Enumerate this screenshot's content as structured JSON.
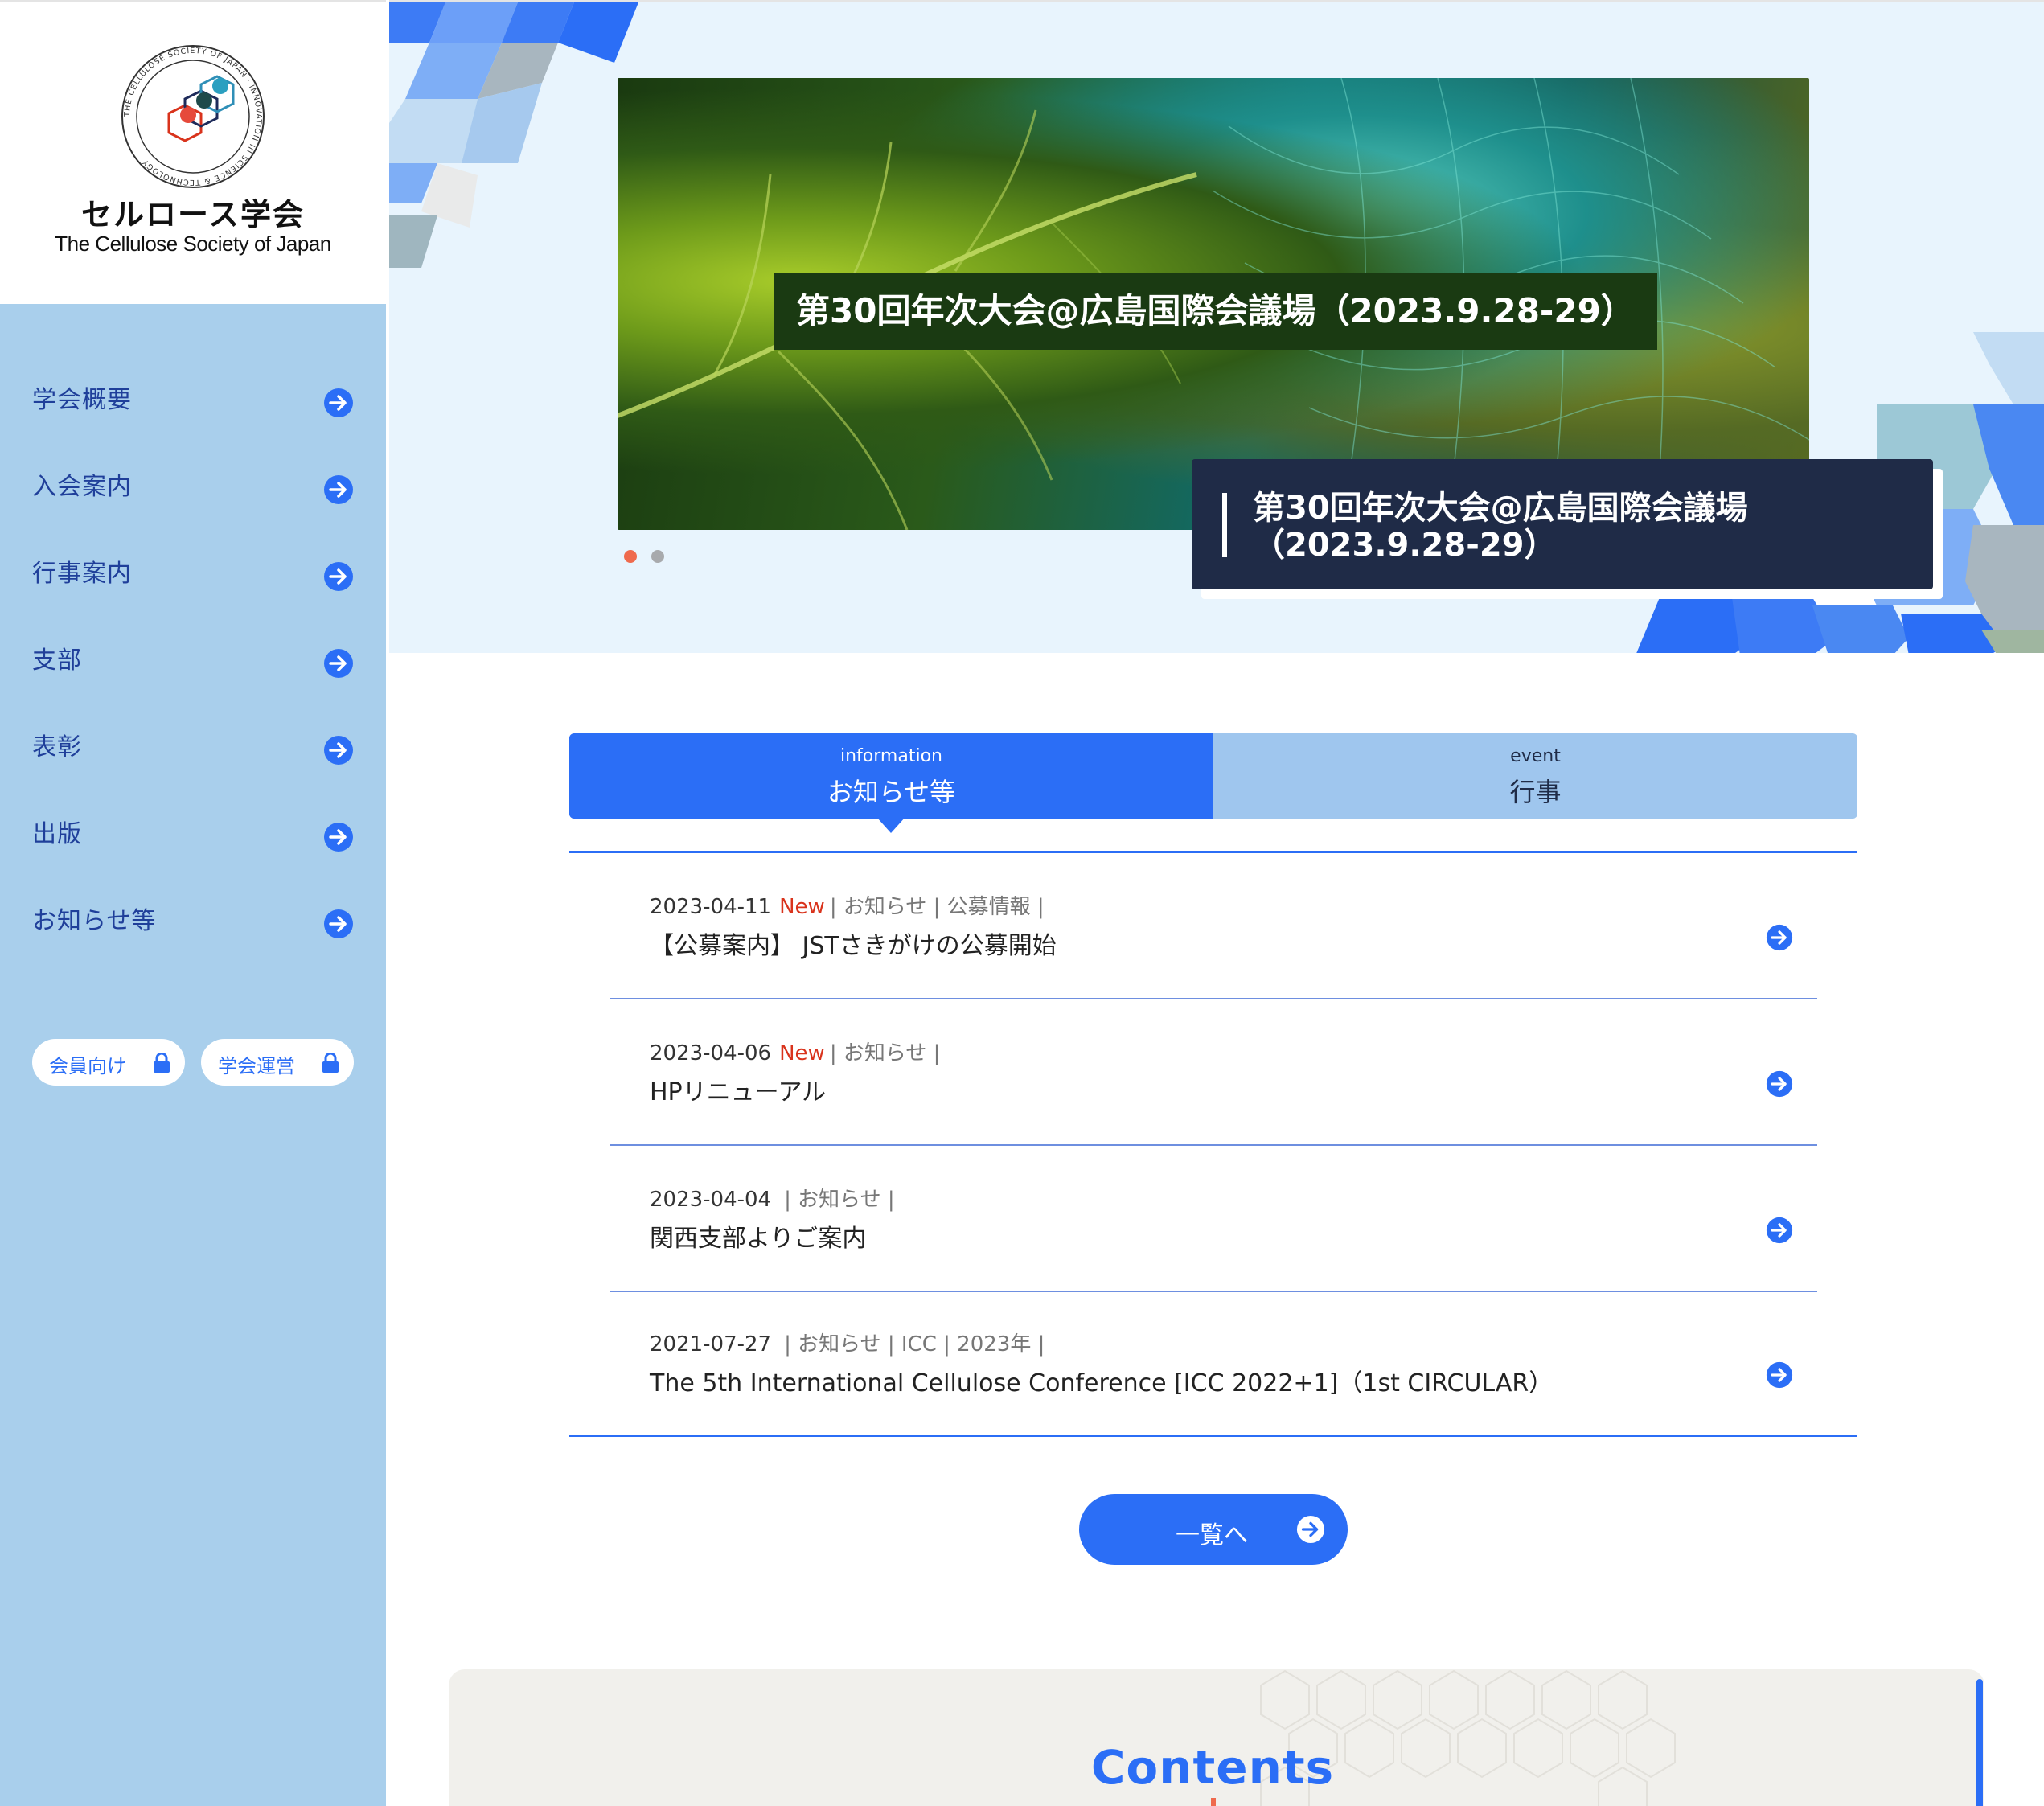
{
  "site": {
    "name_jp": "セルロース学会",
    "name_en": "The Cellulose Society of Japan",
    "logo_ring_text": "THE CELLULOSE SOCIETY OF JAPAN · INNOVATION IN SCIENCE & TECHNOLOGY"
  },
  "sidebar": {
    "nav": [
      {
        "label": "学会概要",
        "icon": "arrow-right-circle-icon"
      },
      {
        "label": "入会案内",
        "icon": "arrow-right-circle-icon"
      },
      {
        "label": "行事案内",
        "icon": "arrow-right-circle-icon"
      },
      {
        "label": "支部",
        "icon": "arrow-right-circle-icon"
      },
      {
        "label": "表彰",
        "icon": "arrow-right-circle-icon"
      },
      {
        "label": "出版",
        "icon": "arrow-right-circle-icon"
      },
      {
        "label": "お知らせ等",
        "icon": "arrow-right-circle-icon"
      }
    ],
    "member_links": [
      {
        "label": "会員向け",
        "icon": "lock-icon"
      },
      {
        "label": "学会運営",
        "icon": "lock-icon"
      }
    ]
  },
  "hero": {
    "slide_caption": "第30回年次大会@広島国際会議場（2023.9.28-29）",
    "card_title_line1": "第30回年次大会@広島国際会議場",
    "card_title_line2": "（2023.9.28-29）",
    "slide_count": 2,
    "active_slide": 1
  },
  "tabs": [
    {
      "en": "information",
      "jp": "お知らせ等",
      "active": true
    },
    {
      "en": "event",
      "jp": "行事",
      "active": false
    }
  ],
  "news": [
    {
      "date": "2023-04-11",
      "new": "New",
      "categories": "| お知らせ | 公募情報 |",
      "title": "【公募案内】 JSTさきがけの公募開始"
    },
    {
      "date": "2023-04-06",
      "new": "New",
      "categories": "| お知らせ |",
      "title": "HPリニューアル"
    },
    {
      "date": "2023-04-04",
      "new": "",
      "categories": "| お知らせ |",
      "title": "関西支部よりご案内"
    },
    {
      "date": "2021-07-27",
      "new": "",
      "categories": "| お知らせ | ICC | 2023年 |",
      "title": "The 5th International Cellulose Conference [ICC 2022+1]（1st CIRCULAR）"
    }
  ],
  "more_button": {
    "label": "一覧へ"
  },
  "contents_section": {
    "title": "Contents"
  },
  "colors": {
    "accent": "#2b6ef6",
    "sidebar_bg": "#a9cfec",
    "hero_bg": "#e8f4fd",
    "card_bg": "#1f2b47",
    "new_badge": "#d9331c",
    "dot_active": "#ef6a4d"
  }
}
